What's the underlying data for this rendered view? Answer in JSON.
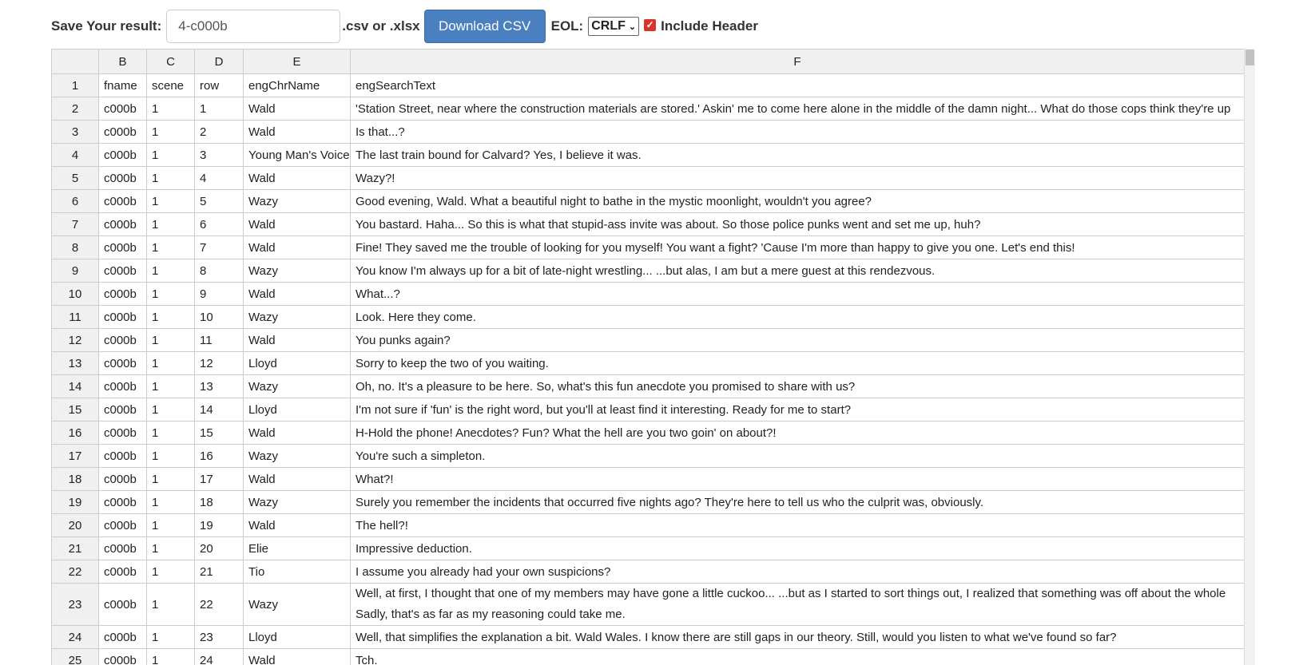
{
  "toolbar": {
    "save_label": "Save Your result:",
    "filename_value": "4-c000b",
    "ext_label": ".csv or .xlsx",
    "download_label": "Download CSV",
    "eol_label": "EOL:",
    "eol_value": "CRLF",
    "include_header_label": "Include Header",
    "include_header_checked": true
  },
  "grid": {
    "column_headers": [
      "",
      "B",
      "C",
      "D",
      "E",
      "F"
    ],
    "rows": [
      [
        "1",
        "fname",
        "scene",
        "row",
        "engChrName",
        "engSearchText"
      ],
      [
        "2",
        "c000b",
        "1",
        "1",
        "Wald",
        "'Station Street, near where the construction materials are stored.' Askin' me to come here alone in the middle of the damn night... What do those cops think they're up"
      ],
      [
        "3",
        "c000b",
        "1",
        "2",
        "Wald",
        "Is that...?"
      ],
      [
        "4",
        "c000b",
        "1",
        "3",
        "Young Man's Voice",
        "The last train bound for Calvard? Yes, I believe it was."
      ],
      [
        "5",
        "c000b",
        "1",
        "4",
        "Wald",
        "Wazy?!"
      ],
      [
        "6",
        "c000b",
        "1",
        "5",
        "Wazy",
        "Good evening, Wald. What a beautiful night to bathe in the mystic moonlight, wouldn't you agree?"
      ],
      [
        "7",
        "c000b",
        "1",
        "6",
        "Wald",
        "You bastard. Haha... So this is what that stupid-ass invite was about. So those police punks went and set me up, huh?"
      ],
      [
        "8",
        "c000b",
        "1",
        "7",
        "Wald",
        "Fine! They saved me the trouble of looking for you myself! You want a fight? 'Cause I'm more than happy to give you one. Let's end this!"
      ],
      [
        "9",
        "c000b",
        "1",
        "8",
        "Wazy",
        "You know I'm always up for a bit of late-night wrestling... ...but alas, I am but a mere guest at this rendezvous."
      ],
      [
        "10",
        "c000b",
        "1",
        "9",
        "Wald",
        "What...?"
      ],
      [
        "11",
        "c000b",
        "1",
        "10",
        "Wazy",
        "Look. Here they come."
      ],
      [
        "12",
        "c000b",
        "1",
        "11",
        "Wald",
        "You punks again?"
      ],
      [
        "13",
        "c000b",
        "1",
        "12",
        "Lloyd",
        "Sorry to keep the two of you waiting."
      ],
      [
        "14",
        "c000b",
        "1",
        "13",
        "Wazy",
        "Oh, no. It's a pleasure to be here. So, what's this fun anecdote you promised to share with us?"
      ],
      [
        "15",
        "c000b",
        "1",
        "14",
        "Lloyd",
        "I'm not sure if 'fun' is the right word, but you'll at least find it interesting. Ready for me to start?"
      ],
      [
        "16",
        "c000b",
        "1",
        "15",
        "Wald",
        "H-Hold the phone! Anecdotes? Fun? What the hell are you two goin' on about?!"
      ],
      [
        "17",
        "c000b",
        "1",
        "16",
        "Wazy",
        "You're such a simpleton."
      ],
      [
        "18",
        "c000b",
        "1",
        "17",
        "Wald",
        "What?!"
      ],
      [
        "19",
        "c000b",
        "1",
        "18",
        "Wazy",
        "Surely you remember the incidents that occurred five nights ago? They're here to tell us who the culprit was, obviously."
      ],
      [
        "20",
        "c000b",
        "1",
        "19",
        "Wald",
        "The hell?!"
      ],
      [
        "21",
        "c000b",
        "1",
        "20",
        "Elie",
        "Impressive deduction."
      ],
      [
        "22",
        "c000b",
        "1",
        "21",
        "Tio",
        "I assume you already had your own suspicions?"
      ],
      [
        "23",
        "c000b",
        "1",
        "22",
        "Wazy",
        "Well, at first, I thought that one of my members may have gone a little cuckoo... ...but as I started to sort things out, I realized that something was off about the whole Sadly, that's as far as my reasoning could take me."
      ],
      [
        "24",
        "c000b",
        "1",
        "23",
        "Lloyd",
        "Well, that simplifies the explanation a bit. Wald Wales. I know there are still gaps in our theory. Still, would you listen to what we've found so far?"
      ],
      [
        "25",
        "c000b",
        "1",
        "24",
        "Wald",
        "Tch."
      ]
    ]
  }
}
